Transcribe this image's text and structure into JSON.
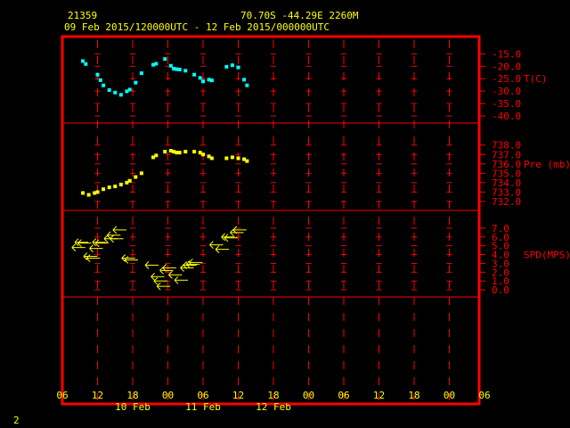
{
  "header": {
    "station": "21359",
    "location": "70.70S   -44.29E   2260M",
    "period": "09 Feb 2015/120000UTC - 12 Feb 2015/000000UTC"
  },
  "page_number": "2",
  "colors": {
    "frame": "#ff0000",
    "text": "#ffff00",
    "temperature": "#00ffff",
    "pressure": "#ffff00",
    "wind": "#ffff00"
  },
  "chart_data": {
    "type": "scatter",
    "x_axis": {
      "start": "09 Feb 2015 06 UTC",
      "end": "12 Feb 2015 06 UTC",
      "hour_ticks": [
        "06",
        "12",
        "18",
        "00",
        "06",
        "12",
        "18",
        "00",
        "06",
        "12",
        "18",
        "00",
        "06"
      ],
      "day_labels": [
        {
          "label": "10 Feb",
          "hours_from_start": 24
        },
        {
          "label": "11 Feb",
          "hours_from_start": 48
        },
        {
          "label": "12 Feb",
          "hours_from_start": 72
        }
      ]
    },
    "panels": [
      {
        "name": "T(C)",
        "ylim": [
          -40.0,
          -12.0
        ],
        "ticks": [
          "-15.0",
          "-20.0",
          "-25.0",
          "-30.0",
          "-35.0",
          "-40.0"
        ],
        "tick_values": [
          -15,
          -20,
          -25,
          -30,
          -35,
          -40
        ],
        "x_hours": [
          7,
          8,
          12,
          13,
          14,
          16,
          18,
          20,
          22,
          23,
          25,
          27,
          31,
          32,
          35,
          37,
          38,
          39,
          40,
          42,
          45,
          47,
          48,
          50,
          51,
          56,
          58,
          60,
          62,
          63
        ],
        "values": [
          -17.9,
          -19.1,
          -23.4,
          -25.6,
          -27.7,
          -29.6,
          -30.6,
          -31.5,
          -30.1,
          -29.4,
          -26.6,
          -22.8,
          -19.4,
          -19.0,
          -17.1,
          -19.8,
          -21.0,
          -21.2,
          -21.3,
          -21.8,
          -23.4,
          -24.7,
          -26.1,
          -25.4,
          -25.7,
          -20.2,
          -19.6,
          -20.5,
          -25.4,
          -27.7
        ]
      },
      {
        "name": "Pre (mb)",
        "ylim": [
          731.8,
          739.4
        ],
        "ticks": [
          "738.0",
          "737.0",
          "736.0",
          "735.0",
          "734.0",
          "733.0",
          "732.0"
        ],
        "tick_values": [
          738,
          737,
          736,
          735,
          734,
          733,
          732
        ],
        "x_hours": [
          7,
          9,
          11,
          12,
          14,
          16,
          18,
          20,
          22,
          23,
          25,
          27,
          31,
          32,
          35,
          37,
          38,
          39,
          40,
          42,
          45,
          47,
          48,
          50,
          51,
          56,
          58,
          60,
          62,
          63
        ],
        "values": [
          732.9,
          732.7,
          732.9,
          733.0,
          733.3,
          733.5,
          733.6,
          733.8,
          734.0,
          734.2,
          734.6,
          735.0,
          736.7,
          736.9,
          737.3,
          737.4,
          737.3,
          737.2,
          737.2,
          737.3,
          737.3,
          737.2,
          737.0,
          736.8,
          736.6,
          736.6,
          736.7,
          736.6,
          736.5,
          736.3
        ]
      },
      {
        "name": "SPD(MPS)",
        "ylim": [
          -0.5,
          8.0
        ],
        "ticks": [
          "7.0",
          "6.0",
          "5.0",
          "4.0",
          "3.0",
          "2.0",
          "1.0",
          "0.0"
        ],
        "tick_values": [
          7,
          6,
          5,
          4,
          3,
          2,
          1,
          0
        ],
        "x_hours": [
          6,
          7,
          8,
          10,
          11,
          12,
          13,
          14,
          17,
          18,
          19,
          20,
          23,
          24,
          31,
          33,
          34,
          35,
          36,
          37,
          39,
          41,
          43,
          44,
          45,
          46,
          53,
          55,
          57,
          58,
          60,
          61
        ],
        "values": [
          4.8,
          5.4,
          5.3,
          3.8,
          3.6,
          4.7,
          5.4,
          5.3,
          5.8,
          6.2,
          5.8,
          6.8,
          3.6,
          3.4,
          2.8,
          1.5,
          1.0,
          0.4,
          2.2,
          2.5,
          1.7,
          1.1,
          2.5,
          2.8,
          2.9,
          3.1,
          5.1,
          4.6,
          6.0,
          5.9,
          6.5,
          6.8
        ]
      }
    ],
    "grid": true
  }
}
